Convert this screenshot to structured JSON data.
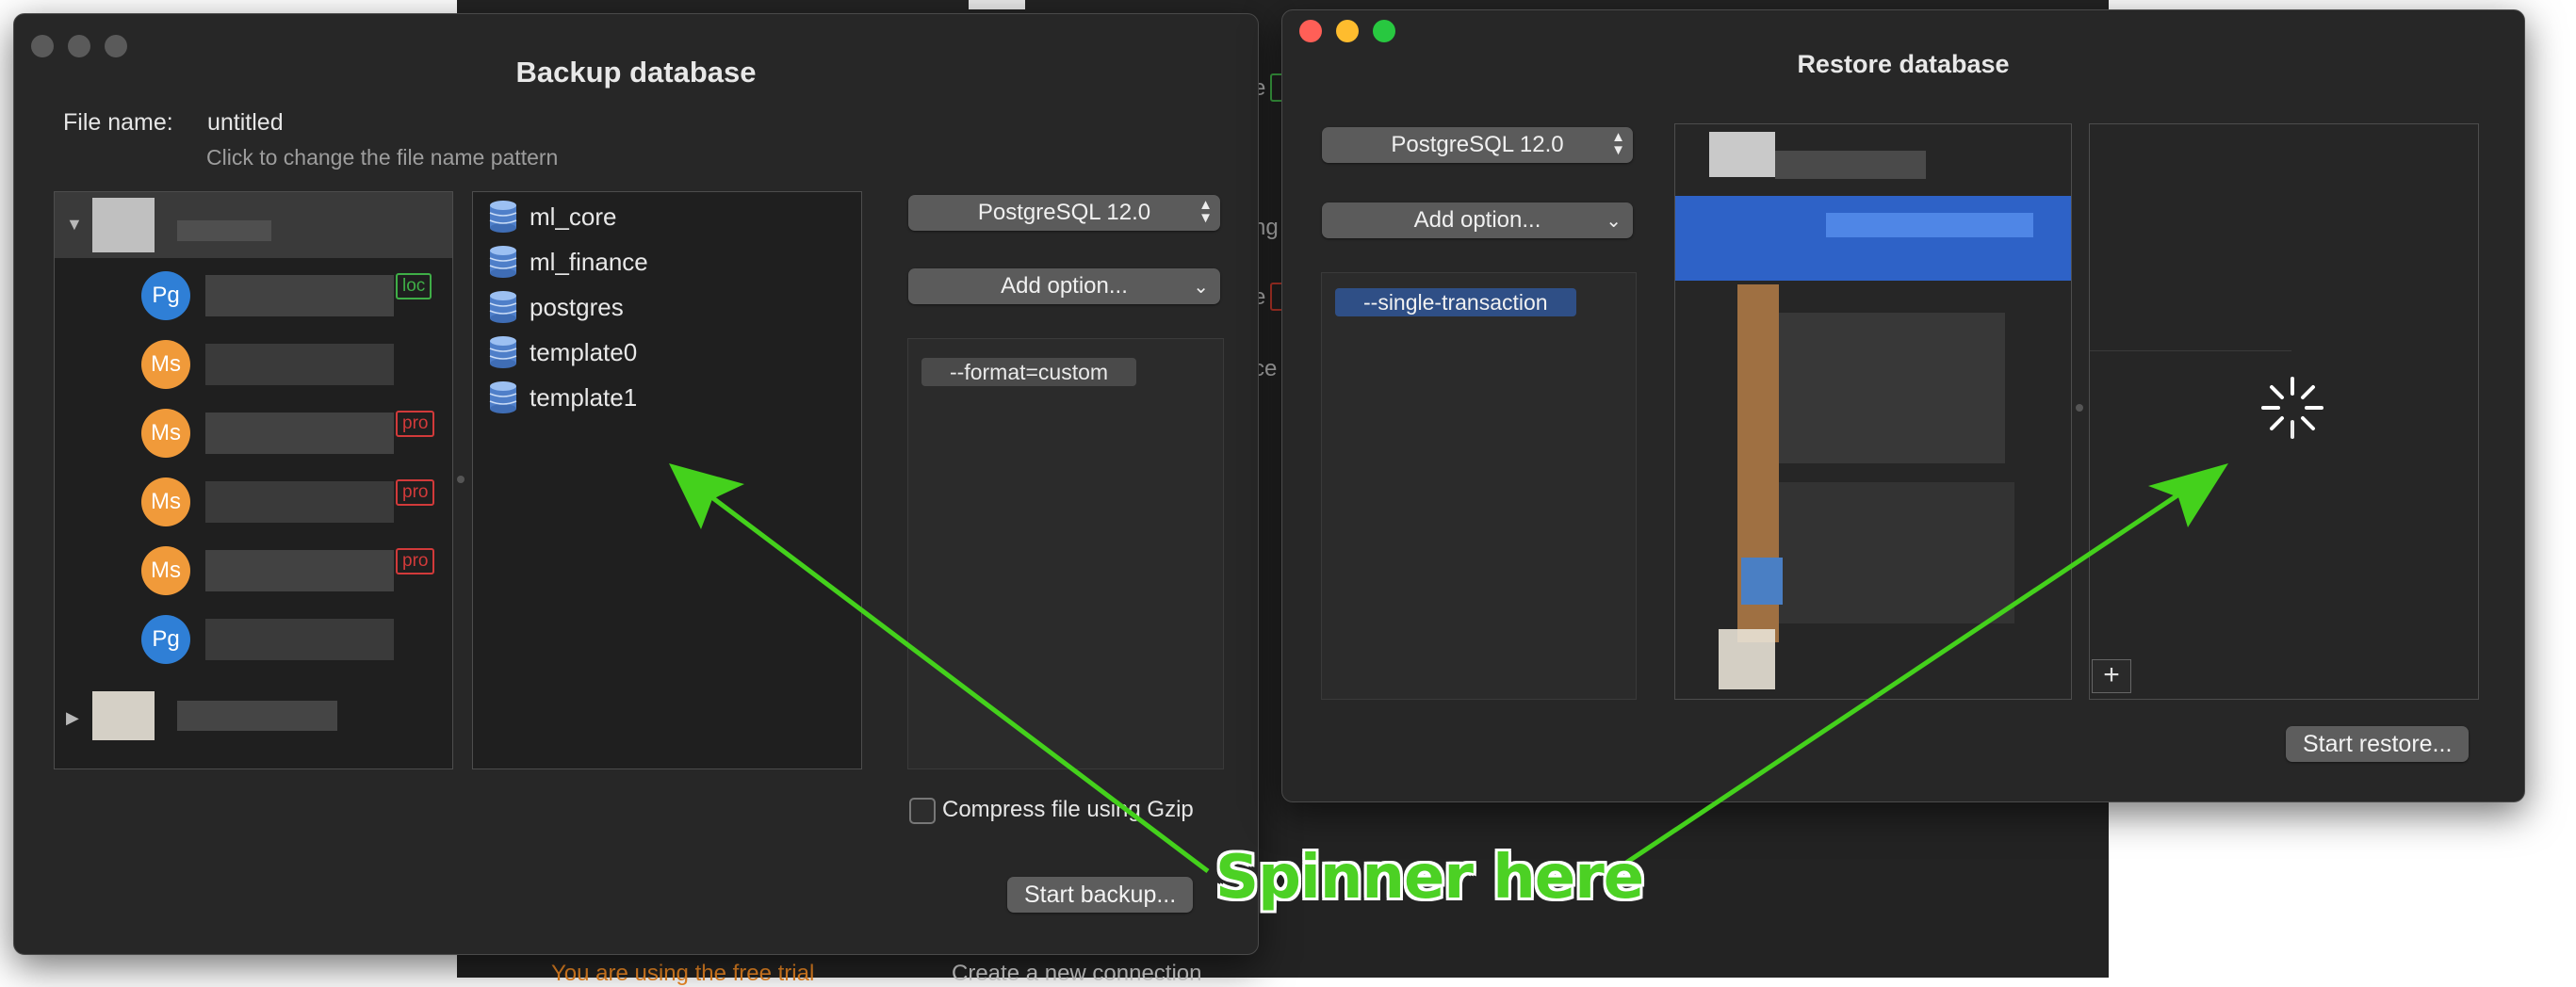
{
  "background_app": {
    "trial_notice": "You are using the free trial",
    "create_connection": "Create a new connection"
  },
  "backup": {
    "title": "Backup database",
    "file_name_label": "File name:",
    "file_name_value": "untitled",
    "file_name_hint": "Click to change the file name pattern",
    "servers": [
      {
        "avatar": "Pg",
        "kind": "pg",
        "tag": "loc",
        "tag_kind": "loc"
      },
      {
        "avatar": "Ms",
        "kind": "ms",
        "tag": "",
        "tag_kind": ""
      },
      {
        "avatar": "Ms",
        "kind": "ms",
        "tag": "pro",
        "tag_kind": "pro"
      },
      {
        "avatar": "Ms",
        "kind": "ms",
        "tag": "pro",
        "tag_kind": "pro"
      },
      {
        "avatar": "Ms",
        "kind": "ms",
        "tag": "pro",
        "tag_kind": "pro"
      },
      {
        "avatar": "Pg",
        "kind": "pg",
        "tag": "",
        "tag_kind": ""
      }
    ],
    "databases": [
      "ml_core",
      "ml_finance",
      "postgres",
      "template0",
      "template1"
    ],
    "version_select": "PostgreSQL 12.0",
    "add_option": "Add option...",
    "options": [
      "--format=custom"
    ],
    "compress_label": "Compress file using Gzip",
    "compress_checked": false,
    "start_button": "Start backup..."
  },
  "restore": {
    "title": "Restore database",
    "version_select": "PostgreSQL 12.0",
    "add_option": "Add option...",
    "options": [
      "--single-transaction"
    ],
    "add_button": "+",
    "start_button": "Start restore..."
  },
  "annotation": {
    "text": "Spinner here",
    "color": "#4cd124"
  }
}
